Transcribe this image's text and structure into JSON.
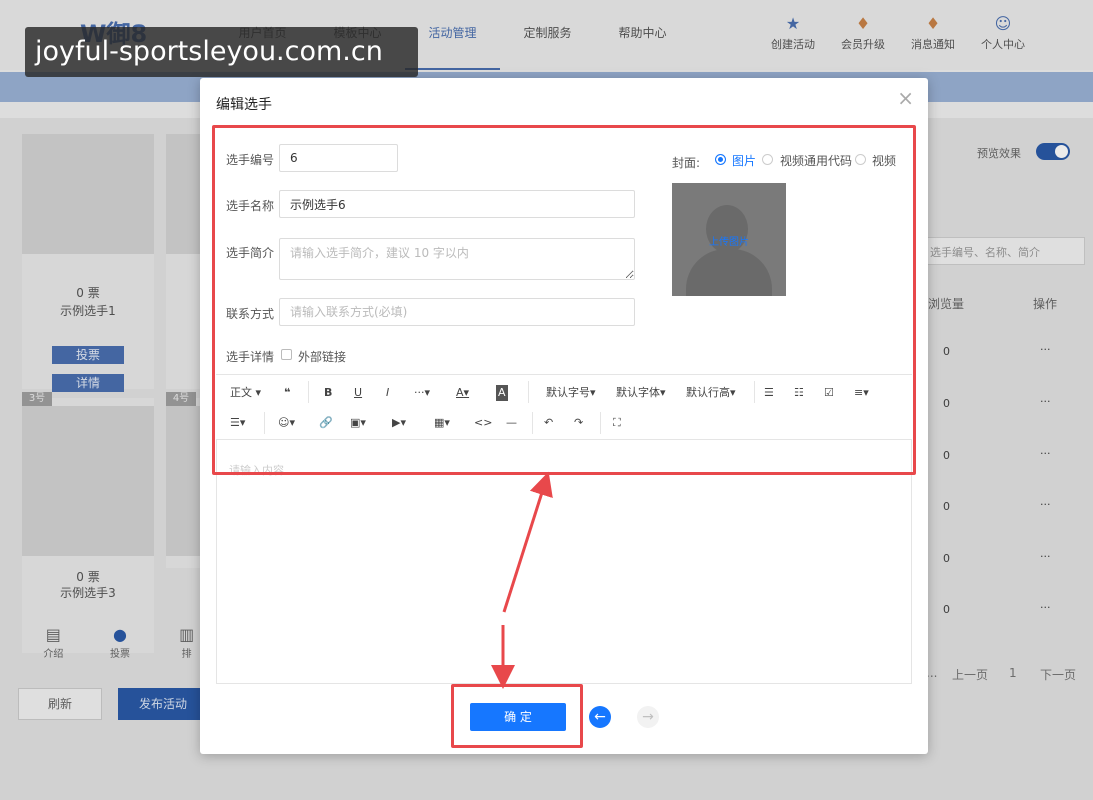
{
  "watermark": "joyful-sportsleyou.com.cn",
  "app": {
    "logo": "W御8",
    "nav": [
      "用户首页",
      "模板中心",
      "活动管理",
      "定制服务",
      "帮助中心"
    ],
    "top_actions": [
      {
        "icon": "star-icon",
        "label": "创建活动"
      },
      {
        "icon": "vip-icon",
        "label": "会员升级"
      },
      {
        "icon": "bell-icon",
        "label": "消息通知"
      },
      {
        "icon": "user-icon",
        "label": "个人中心"
      }
    ],
    "cards": [
      {
        "votes": "0 票",
        "name": "示例选手1",
        "vote_btn": "投票",
        "detail_btn": "详情"
      },
      {
        "tag": "3号",
        "votes": "0 票",
        "name": "示例选手3"
      },
      {
        "tag": "4号"
      }
    ],
    "bottom_tabs": [
      {
        "icon": "doc-icon",
        "label": "介绍"
      },
      {
        "icon": "person-icon",
        "label": "投票"
      },
      {
        "icon": "chart-icon",
        "label": "排"
      }
    ],
    "refresh": "刷新",
    "publish": "发布活动",
    "preview_label": "预览效果",
    "search_placeholder": "选手编号、名称、简介",
    "table_headers": [
      "浏览量",
      "操作"
    ],
    "rows": [
      "0",
      "0",
      "0",
      "0",
      "0",
      "0"
    ],
    "row_action": "···",
    "pager": {
      "prev": "上一页",
      "page": "1",
      "next": "下一页",
      "ellipsis": "..."
    }
  },
  "dialog": {
    "title": "编辑选手",
    "close": "×",
    "fields": {
      "number_label": "选手编号",
      "number_value": "6",
      "name_label": "选手名称",
      "name_value": "示例选手6",
      "intro_label": "选手简介",
      "intro_placeholder": "请输入选手简介，建议 10 字以内",
      "contact_label": "联系方式",
      "contact_placeholder": "请输入联系方式(必填)",
      "detail_label": "选手详情",
      "external_link": "外部链接"
    },
    "cover": {
      "label": "封面:",
      "options": [
        "图片",
        "视频通用代码",
        "视频"
      ],
      "selected": "图片",
      "upload": "上传图片"
    },
    "toolbar": {
      "row1": [
        "正文",
        "❝",
        "B",
        "U",
        "I",
        "···",
        "A",
        "A",
        "默认字号",
        "默认字体",
        "默认行高",
        "☰",
        "☷",
        "☑",
        "≡"
      ],
      "row2": [
        "☰",
        "☺",
        "🔗",
        "▣",
        "▶",
        "▦",
        "<>",
        "—",
        "↶",
        "↷",
        "⛶"
      ]
    },
    "editor_placeholder": "请输入内容...",
    "confirm": "确 定",
    "back_arrow": "←",
    "forward_arrow": "→"
  },
  "colors": {
    "accent": "#1677ff",
    "annotation": "#e8484b",
    "app_blue": "#4a6fb0"
  }
}
